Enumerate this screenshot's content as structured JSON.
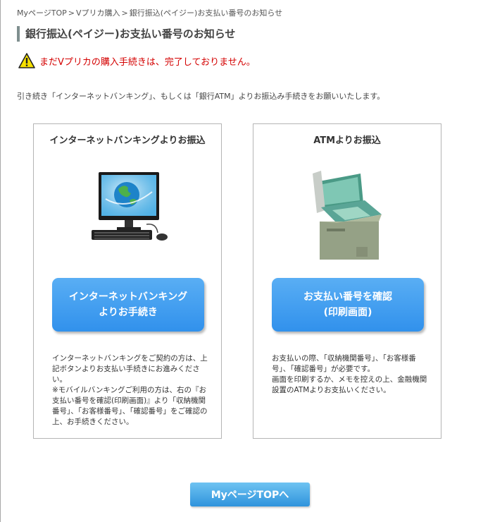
{
  "breadcrumb": {
    "items": [
      "MyページTOP",
      "Vプリカ購入",
      "銀行振込(ペイジー)お支払い番号のお知らせ"
    ],
    "separator": ">"
  },
  "page": {
    "title": "銀行振込(ペイジー)お支払い番号のお知らせ",
    "warning": "まだVプリカの購入手続きは、完了しておりません。",
    "intro": "引き続き「インターネットバンキング」、もしくは「銀行ATM」よりお振込み手続きをお願いいたします。"
  },
  "cards": {
    "net": {
      "title": "インターネットバンキングよりお振込",
      "icon": "computer-globe-icon",
      "button_line1": "インターネットバンキング",
      "button_line2": "よりお手続き",
      "desc1": "インターネットバンキングをご契約の方は、上記ボタンよりお支払い手続きにお進みください。",
      "desc2": "※モバイルバンキングご利用の方は、右の『お支払い番号を確認(印刷画面)』より「収納機関番号」、「お客様番号」、「確認番号」をご確認の上、お手続きください。"
    },
    "atm": {
      "title": "ATMよりお振込",
      "icon": "atm-machine-icon",
      "button_line1": "お支払い番号を確認",
      "button_line2": "(印刷画面)",
      "desc1": "お支払いの際、「収納機関番号」、「お客様番号」、「確認番号」が必要です。",
      "desc2": "画面を印刷するか、メモを控えの上、金融機関設置のATMよりお支払いください。"
    }
  },
  "footer": {
    "top_button": "MyページTOPへ"
  },
  "colors": {
    "warning_text": "#d40000",
    "button_blue": "#3191ec",
    "top_button_blue": "#2f93dc",
    "border_gray": "#b5b5b5"
  }
}
